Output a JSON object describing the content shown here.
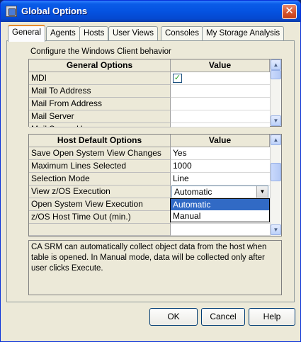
{
  "window": {
    "title": "Global Options",
    "close_glyph": "✕"
  },
  "tabs": [
    {
      "label": "General",
      "active": true
    },
    {
      "label": "Agents"
    },
    {
      "label": "Hosts"
    },
    {
      "label": "User Views"
    },
    {
      "label": "Consoles"
    },
    {
      "label": "My Storage Analysis"
    }
  ],
  "caption": "Configure the Windows Client behavior",
  "general_grid": {
    "col_option": "General Options",
    "col_value": "Value",
    "rows": [
      {
        "label": "MDI",
        "checked": true
      },
      {
        "label": "Mail To Address",
        "value": ""
      },
      {
        "label": "Mail From Address",
        "value": ""
      },
      {
        "label": "Mail Server",
        "value": ""
      },
      {
        "label": "Mail Server User",
        "value": ""
      }
    ]
  },
  "host_grid": {
    "col_option": "Host Default Options",
    "col_value": "Value",
    "rows": [
      {
        "label": "Save Open System View Changes",
        "value": "Yes"
      },
      {
        "label": "Maximum Lines Selected",
        "value": "1000"
      },
      {
        "label": "Selection Mode",
        "value": "Line"
      },
      {
        "label": "View z/OS Execution",
        "value": "Automatic"
      },
      {
        "label": "Open System View Execution",
        "value": ""
      },
      {
        "label": "z/OS Host Time Out (min.)",
        "value": ""
      },
      {
        "label": "",
        "value": ""
      }
    ]
  },
  "dropdown_options": [
    "Automatic",
    "Manual"
  ],
  "description": "CA SRM can automatically collect object data from the host when table is opened. In Manual mode, data will be collected only after user clicks Execute.",
  "buttons": {
    "ok": "OK",
    "cancel": "Cancel",
    "help": "Help"
  },
  "colors": {
    "title_bar": "#0553e1",
    "selection": "#316ac5",
    "close": "#d5512a"
  }
}
